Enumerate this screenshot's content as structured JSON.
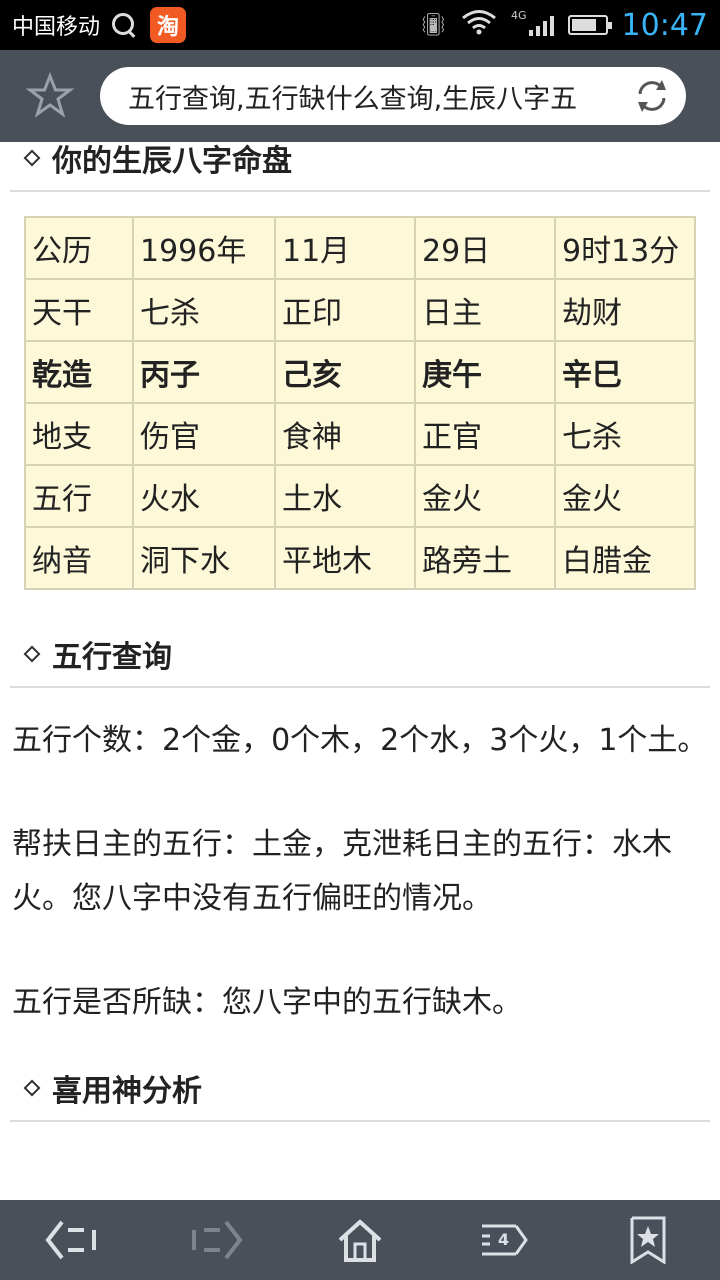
{
  "status_bar": {
    "carrier": "中国移动",
    "taobao_icon": "淘",
    "network": "4G",
    "battery_level": 0.75,
    "time": "10:47"
  },
  "address_bar": {
    "url_text": "五行查询,五行缺什么查询,生辰八字五"
  },
  "sections": {
    "bazi_title": "你的生辰八字命盘",
    "wuxing_title": "五行查询",
    "xiyong_title": "喜用神分析"
  },
  "bazi_table": {
    "rows": [
      [
        "公历",
        "1996年",
        "11月",
        "29日",
        "9时13分"
      ],
      [
        "天干",
        "七杀",
        "正印",
        "日主",
        "劫财"
      ],
      [
        "乾造",
        "丙子",
        "己亥",
        "庚午",
        "辛巳"
      ],
      [
        "地支",
        "伤官",
        "食神",
        "正官",
        "七杀"
      ],
      [
        "五行",
        "火水",
        "土水",
        "金火",
        "金火"
      ],
      [
        "纳音",
        "洞下水",
        "平地木",
        "路旁土",
        "白腊金"
      ]
    ]
  },
  "wuxing": {
    "count_text": "五行个数：2个金，0个木，2个水，3个火，1个土。",
    "help_text": "帮扶日主的五行：土金，克泄耗日主的五行：水木火。您八字中没有五行偏旺的情况。",
    "missing_text": "五行是否所缺：您八字中的五行缺木。"
  },
  "bottom_nav": {
    "tab_count": "4"
  },
  "icons": {
    "bookmark_star": "star-icon",
    "refresh": "refresh-icon",
    "back": "back-icon",
    "forward": "forward-icon",
    "home": "home-icon",
    "tabs": "tabs-icon",
    "bookmarks": "bookmarks-icon"
  }
}
